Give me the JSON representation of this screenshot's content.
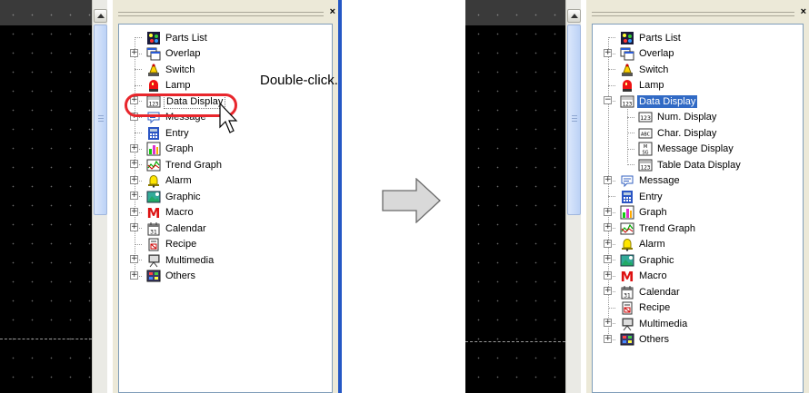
{
  "left": {
    "tree_items": [
      {
        "label": "Parts List",
        "icon": "parts-list-icon"
      },
      {
        "label": "Overlap",
        "icon": "overlap-icon",
        "expander": "+"
      },
      {
        "label": "Switch",
        "icon": "switch-icon"
      },
      {
        "label": "Lamp",
        "icon": "lamp-icon"
      },
      {
        "label": "Data Display",
        "icon": "data-display-icon",
        "expander": "+"
      },
      {
        "label": "Message",
        "icon": "message-icon",
        "expander": "+"
      },
      {
        "label": "Entry",
        "icon": "entry-icon"
      },
      {
        "label": "Graph",
        "icon": "graph-icon",
        "expander": "+"
      },
      {
        "label": "Trend Graph",
        "icon": "trend-graph-icon",
        "expander": "+"
      },
      {
        "label": "Alarm",
        "icon": "alarm-icon",
        "expander": "+"
      },
      {
        "label": "Graphic",
        "icon": "graphic-icon",
        "expander": "+"
      },
      {
        "label": "Macro",
        "icon": "macro-icon",
        "expander": "+"
      },
      {
        "label": "Calendar",
        "icon": "calendar-icon",
        "expander": "+"
      },
      {
        "label": "Recipe",
        "icon": "recipe-icon"
      },
      {
        "label": "Multimedia",
        "icon": "multimedia-icon",
        "expander": "+"
      },
      {
        "label": "Others",
        "icon": "others-icon",
        "expander": "+"
      }
    ],
    "callout": "Double-click.",
    "close_label": "×"
  },
  "right": {
    "tree_items": [
      {
        "label": "Parts List"
      },
      {
        "label": "Overlap"
      },
      {
        "label": "Switch"
      },
      {
        "label": "Lamp"
      },
      {
        "label": "Data Display"
      },
      {
        "label": "Num. Display"
      },
      {
        "label": "Char. Display"
      },
      {
        "label": "Message Display"
      },
      {
        "label": "Table Data Display"
      },
      {
        "label": "Message"
      },
      {
        "label": "Entry"
      },
      {
        "label": "Graph"
      },
      {
        "label": "Trend Graph"
      },
      {
        "label": "Alarm"
      },
      {
        "label": "Graphic"
      },
      {
        "label": "Macro"
      },
      {
        "label": "Calendar"
      },
      {
        "label": "Recipe"
      },
      {
        "label": "Multimedia"
      },
      {
        "label": "Others"
      }
    ],
    "close_label": "×"
  },
  "icon_text": {
    "num_display": "123",
    "char_display": "ABC",
    "message_display": "MSG",
    "table_display": "123"
  },
  "colors": {
    "selection": "#316ac5",
    "callout_ring": "#e8262c",
    "arrow_fill": "#d9d9d9",
    "arrow_stroke": "#6a6a6a"
  }
}
